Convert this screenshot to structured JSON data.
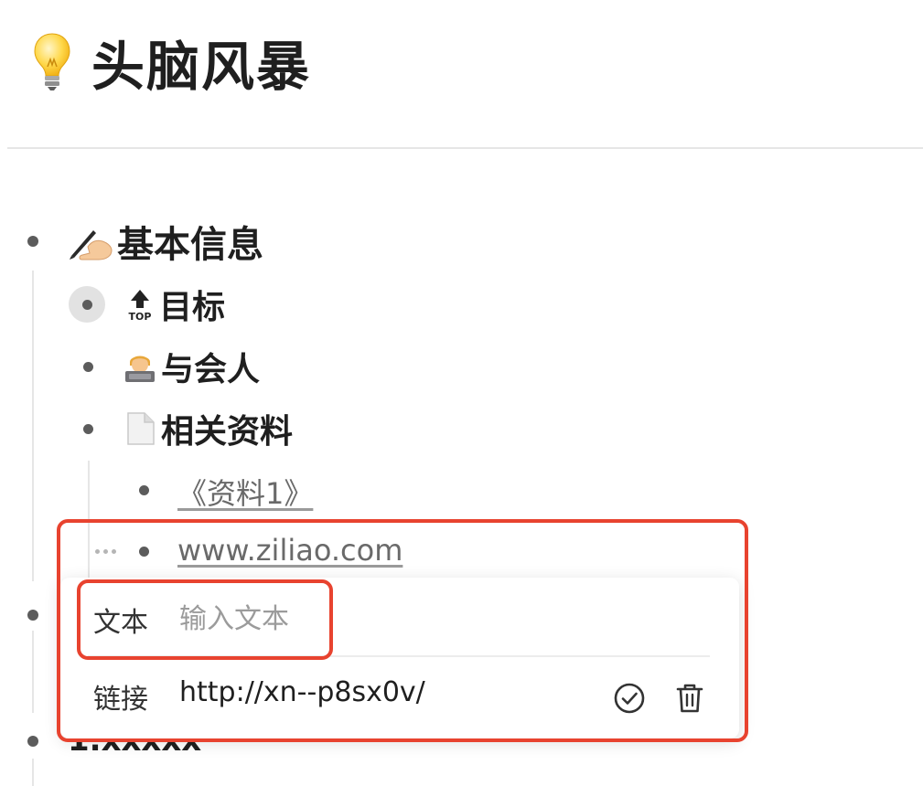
{
  "page": {
    "title": "头脑风暴",
    "title_icon": "lightbulb-icon"
  },
  "outline": {
    "basic_info": {
      "label": "基本信息",
      "icon": "writing-hand-icon"
    },
    "children": [
      {
        "label": "目标",
        "icon": "top-arrow-icon"
      },
      {
        "label": "与会人",
        "icon": "technologist-icon"
      },
      {
        "label": "相关资料",
        "icon": "page-icon"
      }
    ],
    "materials": [
      {
        "label": "《资料1》"
      },
      {
        "label": "www.ziliao.com"
      }
    ],
    "next_item_partial": "1.xxxxx"
  },
  "link_popup": {
    "text_label": "文本",
    "text_placeholder": "输入文本",
    "text_value": "",
    "link_label": "链接",
    "link_value": "http://xn--p8sx0v/",
    "confirm_icon": "check-circle-icon",
    "delete_icon": "trash-icon"
  },
  "colors": {
    "highlight": "#e8432f",
    "text": "#1f1f1f",
    "muted": "#9b9b9b"
  }
}
